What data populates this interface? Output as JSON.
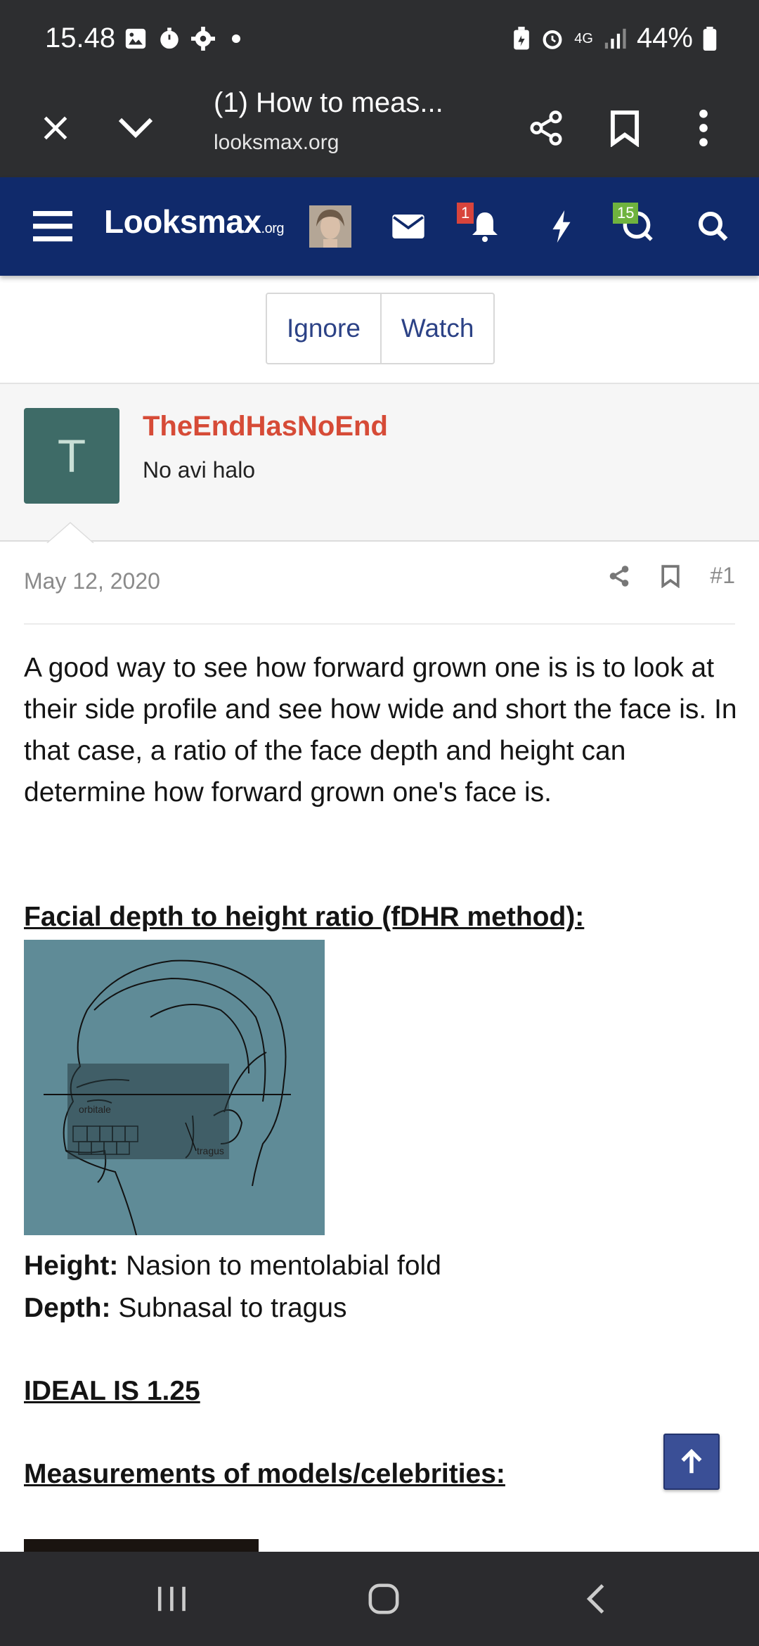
{
  "status_bar": {
    "time": "15.48",
    "battery": "44%",
    "network": "4G"
  },
  "browser": {
    "tab_title": "(1) How to meas...",
    "url": "looksmax.org"
  },
  "site_nav": {
    "logo_main": "Looksmax",
    "logo_suffix": ".org",
    "notifications_count": "1",
    "conversations_count": "15"
  },
  "thread_actions": {
    "ignore": "Ignore",
    "watch": "Watch"
  },
  "user": {
    "avatar_letter": "T",
    "username": "TheEndHasNoEnd",
    "user_title": "No avi halo"
  },
  "post": {
    "date": "May 12, 2020",
    "number": "#1",
    "paragraph": "A good way to see how forward grown one is is to look at their side profile and see how wide and short the face is. In that case, a ratio of the face depth and height can determine how forward grown one's face is.",
    "heading_fdhr": "Facial depth to height ratio (fDHR method):",
    "figure_labels": {
      "orbitale": "orbitale",
      "tragus": "tragus"
    },
    "height_label": "Height:",
    "height_value": " Nasion to mentolabial fold",
    "depth_label": "Depth:",
    "depth_value": " Subnasal to tragus",
    "ideal": "IDEAL IS 1.25",
    "heading_measurements": "Measurements of models/celebrities:"
  },
  "colors": {
    "status_bg": "#2d2e30",
    "nav_bg": "#102a6b",
    "username": "#d64b37",
    "link": "#2c4286",
    "avatar_bg": "#3e6b67",
    "figure_bg": "#5f8b97"
  }
}
